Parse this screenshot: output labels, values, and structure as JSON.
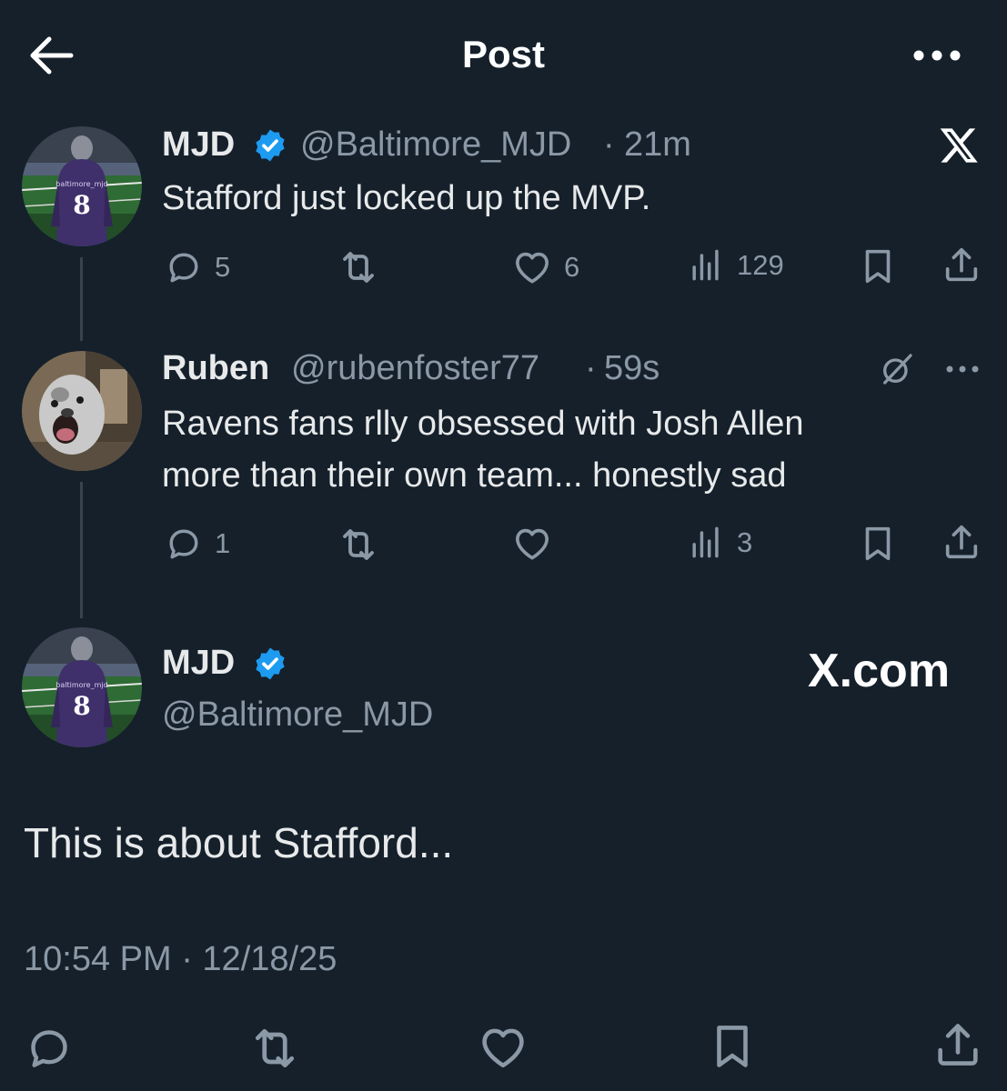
{
  "header": {
    "title": "Post"
  },
  "quoted_tweet": {
    "name": "MJD",
    "handle": "@Baltimore_MJD",
    "separator": "·",
    "time": "21m",
    "text": "Stafford just locked up the MVP.",
    "replies": "5",
    "likes": "6",
    "views": "129"
  },
  "reply_tweet": {
    "name": "Ruben",
    "handle": "@rubenfoster77",
    "separator": "·",
    "time": "59s",
    "text_line1": "Ravens fans rlly obsessed with Josh Allen",
    "text_line2": "more than their own team... honestly sad",
    "replies": "1",
    "views": "3"
  },
  "main_tweet": {
    "name": "MJD",
    "handle": "@Baltimore_MJD",
    "watermark": "X.com",
    "text": "This is about Stafford...",
    "timestamp": "10:54 PM · 12/18/25"
  },
  "avatar_text": {
    "jersey_number": "8",
    "jersey_name": "baltimore_mjd"
  },
  "icons": {
    "back": "arrow-left-icon",
    "more": "more-horizontal-icon",
    "x_logo": "x-logo-icon",
    "reply": "reply-icon",
    "retweet": "retweet-icon",
    "like": "heart-icon",
    "views": "views-icon",
    "bookmark": "bookmark-icon",
    "share": "share-icon",
    "verified": "verified-badge-icon",
    "grok": "grok-icon"
  },
  "colors": {
    "background": "#15202b",
    "text_primary": "#e7e9ea",
    "text_secondary": "#8b98a5",
    "verified_blue": "#1d9bf0",
    "thread_line": "#38444d"
  }
}
